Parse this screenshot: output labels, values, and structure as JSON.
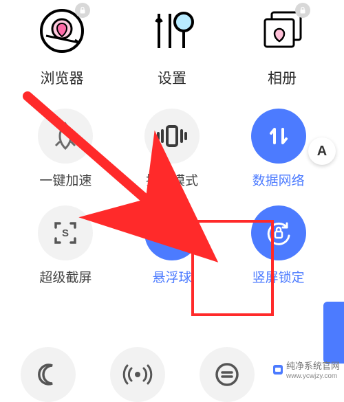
{
  "shortcuts": {
    "browser": {
      "label": "浏览器",
      "locked": true
    },
    "settings": {
      "label": "设置",
      "locked": false
    },
    "gallery": {
      "label": "相册",
      "locked": true
    }
  },
  "quick": {
    "boost": {
      "label": "一键加速",
      "active": false
    },
    "vibrate": {
      "label": "振动模式",
      "active": false
    },
    "data": {
      "label": "数据网络",
      "active": true
    },
    "screenshot": {
      "label": "超级截屏",
      "active": false
    },
    "floatball": {
      "label": "悬浮球",
      "active": true
    },
    "rotlock": {
      "label": "竖屏锁定",
      "active": true
    }
  },
  "edit_badge": "A",
  "watermark": {
    "brand": "纯净系统官网",
    "url": "www.ycwjzy.com"
  },
  "colors": {
    "accent": "#4c7bff",
    "callout": "#ff2a2a",
    "arrow": "#ff2a2a"
  }
}
